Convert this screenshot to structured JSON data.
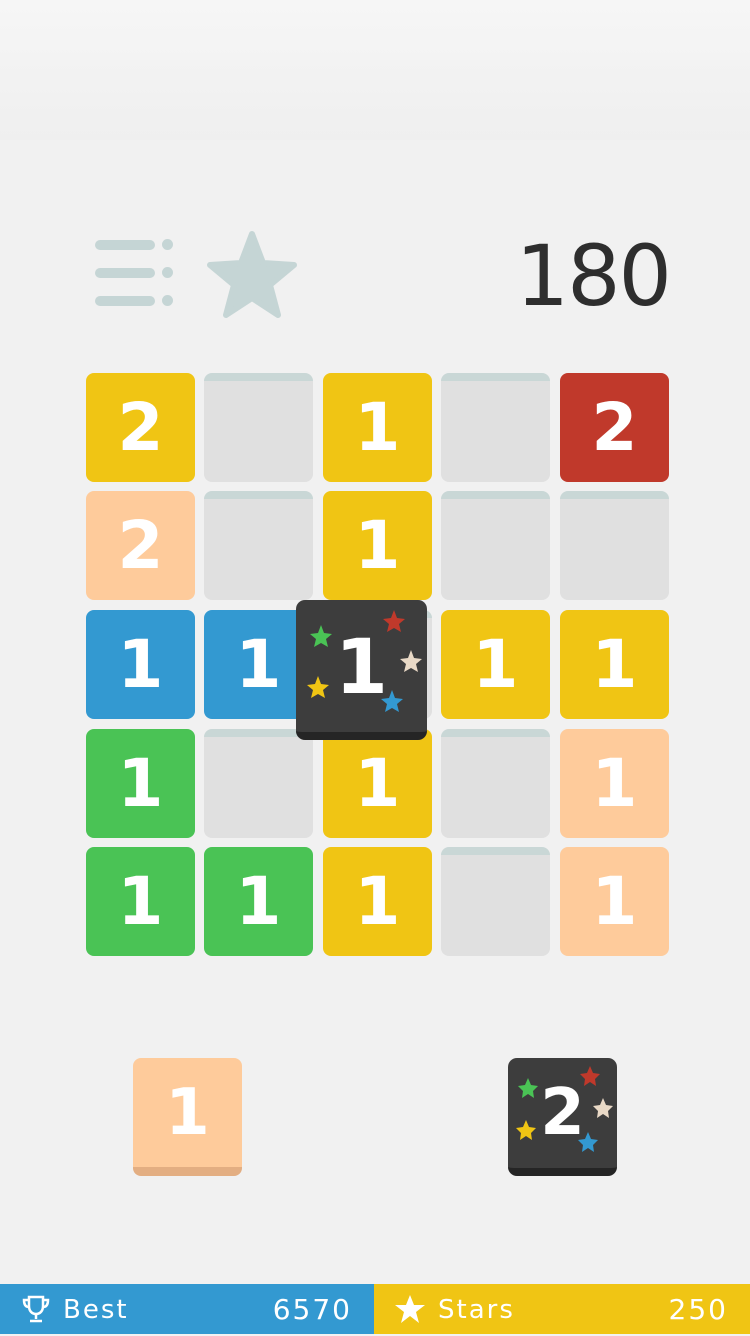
{
  "header": {
    "score": "180",
    "menu_icon": "menu-dots-icon",
    "star_icon": "star-icon"
  },
  "board": {
    "rows": [
      [
        {
          "v": "2",
          "c": "yellow"
        },
        {
          "v": "",
          "c": "empty"
        },
        {
          "v": "1",
          "c": "yellow"
        },
        {
          "v": "",
          "c": "empty"
        },
        {
          "v": "2",
          "c": "red"
        }
      ],
      [
        {
          "v": "2",
          "c": "peach"
        },
        {
          "v": "",
          "c": "empty"
        },
        {
          "v": "1",
          "c": "yellow"
        },
        {
          "v": "",
          "c": "empty"
        },
        {
          "v": "",
          "c": "empty"
        }
      ],
      [
        {
          "v": "1",
          "c": "blue"
        },
        {
          "v": "1",
          "c": "blue"
        },
        {
          "v": "",
          "c": "empty"
        },
        {
          "v": "1",
          "c": "yellow"
        },
        {
          "v": "1",
          "c": "yellow"
        }
      ],
      [
        {
          "v": "1",
          "c": "green"
        },
        {
          "v": "",
          "c": "empty"
        },
        {
          "v": "1",
          "c": "yellow"
        },
        {
          "v": "",
          "c": "empty"
        },
        {
          "v": "1",
          "c": "peach"
        }
      ],
      [
        {
          "v": "1",
          "c": "green"
        },
        {
          "v": "1",
          "c": "green"
        },
        {
          "v": "1",
          "c": "yellow"
        },
        {
          "v": "",
          "c": "empty"
        },
        {
          "v": "1",
          "c": "peach"
        }
      ]
    ],
    "dragging_tile": {
      "v": "1",
      "type": "star-tile"
    }
  },
  "next": {
    "tile_value": "1",
    "star_tile_value": "2"
  },
  "footer": {
    "best_label": "Best",
    "best_value": "6570",
    "stars_label": "Stars",
    "stars_value": "250"
  },
  "colors": {
    "yellow": "#f0c514",
    "red": "#c0392b",
    "peach": "#fecb9b",
    "blue": "#3399d1",
    "green": "#4ac355",
    "empty": "#e0e0e0",
    "dark": "#3d3d3d"
  }
}
